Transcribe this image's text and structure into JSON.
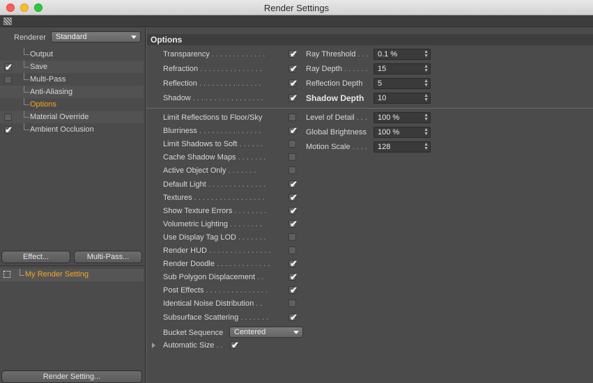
{
  "window": {
    "title": "Render Settings"
  },
  "left": {
    "renderer_label": "Renderer",
    "renderer_value": "Standard",
    "tree": [
      {
        "label": "Output",
        "checked": null,
        "active": false
      },
      {
        "label": "Save",
        "checked": true,
        "active": false
      },
      {
        "label": "Multi-Pass",
        "checked": false,
        "active": false
      },
      {
        "label": "Anti-Aliasing",
        "checked": null,
        "active": false
      },
      {
        "label": "Options",
        "checked": null,
        "active": true
      },
      {
        "label": "Material Override",
        "checked": false,
        "active": false
      },
      {
        "label": "Ambient Occlusion",
        "checked": true,
        "active": false
      }
    ],
    "effect_button": "Effect...",
    "multipass_button": "Multi-Pass...",
    "my_render_setting": "My Render Setting",
    "render_setting_button": "Render Setting..."
  },
  "options": {
    "header": "Options",
    "top_left": [
      {
        "label": "Transparency",
        "dots": " . . . . . . . . . . . . .",
        "checked": true
      },
      {
        "label": "Refraction",
        "dots": " . . . . . . . . . . . . . . .",
        "checked": true
      },
      {
        "label": "Reflection",
        "dots": " . . . . . . . . . . . . . . .",
        "checked": true
      },
      {
        "label": "Shadow",
        "dots": " . . . . . . . . . . . . . . . . .",
        "checked": true
      }
    ],
    "top_right": [
      {
        "label": "Ray Threshold",
        "dots": " . . .",
        "value": "0.1 %",
        "bold": false
      },
      {
        "label": "Ray Depth",
        "dots": " . . . . . .",
        "value": "15",
        "bold": false
      },
      {
        "label": "Reflection Depth",
        "dots": "",
        "value": "5",
        "bold": false
      },
      {
        "label": "Shadow Depth",
        "dots": "",
        "value": "10",
        "bold": true
      }
    ],
    "bottom_left": [
      {
        "label": "Limit Reflections to Floor/Sky",
        "dots": "",
        "checked": false
      },
      {
        "label": "Blurriness",
        "dots": " . . . . . . . . . . . . . . .",
        "checked": true
      },
      {
        "label": "Limit Shadows to Soft",
        "dots": " . . . . . .",
        "checked": false
      },
      {
        "label": "Cache Shadow Maps",
        "dots": " . . . . . . .",
        "checked": false
      },
      {
        "label": "Active Object Only",
        "dots": " . . . . . . .",
        "checked": false
      },
      {
        "label": "Default Light",
        "dots": " . . . . . . . . . . . . . .",
        "checked": true
      },
      {
        "label": "Textures",
        "dots": " . . . . . . . . . . . . . . . . .",
        "checked": true
      },
      {
        "label": "Show Texture Errors",
        "dots": " . . . . . . . .",
        "checked": true
      },
      {
        "label": "Volumetric Lighting",
        "dots": " . . . . . . . .",
        "checked": true
      },
      {
        "label": "Use Display Tag LOD",
        "dots": " . . . . . . .",
        "checked": false
      },
      {
        "label": "Render HUD",
        "dots": " . . . . . . . . . . . . . . .",
        "checked": false
      },
      {
        "label": "Render Doodle",
        "dots": " . . . . . . . . . . . . .",
        "checked": true
      },
      {
        "label": "Sub Polygon Displacement",
        "dots": " . .",
        "checked": true
      },
      {
        "label": "Post Effects",
        "dots": " . . . . . . . . . . . . . . .",
        "checked": true
      },
      {
        "label": "Identical Noise Distribution",
        "dots": " . .",
        "checked": false
      },
      {
        "label": "Subsurface Scattering",
        "dots": " . . . . . . .",
        "checked": true
      }
    ],
    "bottom_right": [
      {
        "label": "Level of Detail",
        "dots": " . . .",
        "value": "100 %"
      },
      {
        "label": "Global Brightness",
        "dots": "",
        "value": "100 %"
      },
      {
        "label": "Motion Scale",
        "dots": " . . . .",
        "value": "128"
      }
    ],
    "bucket_sequence_label": "Bucket Sequence",
    "bucket_sequence_value": "Centered",
    "automatic_size_label": "Automatic Size",
    "automatic_size_dots": " . .",
    "automatic_size_checked": true
  }
}
